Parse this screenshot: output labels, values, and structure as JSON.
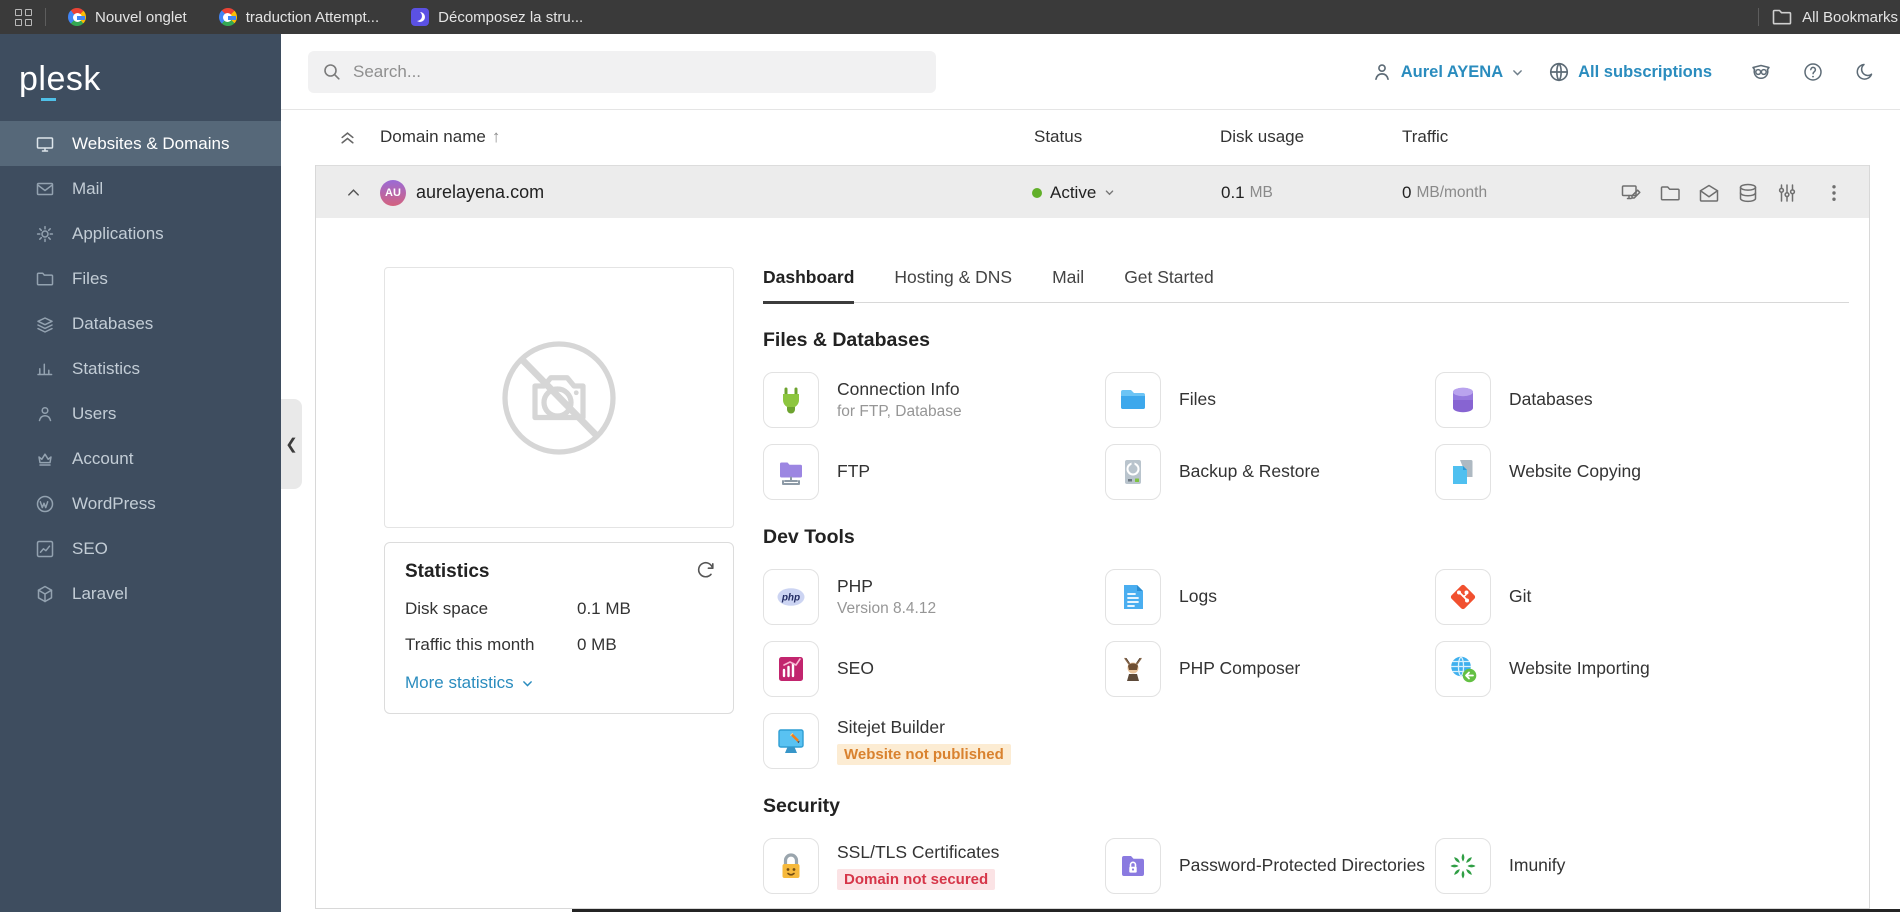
{
  "browser": {
    "tabs": [
      {
        "label": "Nouvel onglet",
        "favicon": "google"
      },
      {
        "label": "traduction Attempt...",
        "favicon": "google"
      },
      {
        "label": "Décomposez la stru...",
        "favicon": "purple"
      }
    ],
    "all_bookmarks_label": "All Bookmarks"
  },
  "sidebar": {
    "logo": "plesk",
    "items": [
      {
        "label": "Websites & Domains",
        "icon": "monitor-icon",
        "active": true
      },
      {
        "label": "Mail",
        "icon": "mail-icon",
        "active": false
      },
      {
        "label": "Applications",
        "icon": "gear-icon",
        "active": false
      },
      {
        "label": "Files",
        "icon": "folder-icon",
        "active": false
      },
      {
        "label": "Databases",
        "icon": "layers-icon",
        "active": false
      },
      {
        "label": "Statistics",
        "icon": "bar-chart-icon",
        "active": false
      },
      {
        "label": "Users",
        "icon": "user-icon",
        "active": false
      },
      {
        "label": "Account",
        "icon": "crown-icon",
        "active": false
      },
      {
        "label": "WordPress",
        "icon": "wordpress-icon",
        "active": false
      },
      {
        "label": "SEO",
        "icon": "seo-chart-icon",
        "active": false
      },
      {
        "label": "Laravel",
        "icon": "laravel-icon",
        "active": false
      }
    ]
  },
  "header": {
    "search_placeholder": "Search...",
    "user_name": "Aurel AYENA",
    "subscriptions_label": "All subscriptions"
  },
  "table": {
    "col_domain": "Domain name",
    "sort_arrow": "↑",
    "col_status": "Status",
    "col_disk": "Disk usage",
    "col_traffic": "Traffic"
  },
  "domain": {
    "avatar_initials": "AU",
    "name": "aurelayena.com",
    "status": "Active",
    "disk_value": "0.1",
    "disk_unit": "MB",
    "traffic_value": "0",
    "traffic_unit": "MB/month",
    "action_icons": [
      "site-preview-icon",
      "folder-outline-icon",
      "mail-outline-icon",
      "database-outline-icon",
      "sliders-icon"
    ]
  },
  "panel": {
    "tabs": [
      {
        "label": "Dashboard",
        "active": true
      },
      {
        "label": "Hosting & DNS",
        "active": false
      },
      {
        "label": "Mail",
        "active": false
      },
      {
        "label": "Get Started",
        "active": false
      }
    ],
    "statistics": {
      "title": "Statistics",
      "rows": [
        {
          "label": "Disk space",
          "value": "0.1 MB"
        },
        {
          "label": "Traffic this month",
          "value": "0 MB"
        }
      ],
      "more_link": "More statistics"
    },
    "sections": [
      {
        "title": "Files & Databases",
        "tiles": [
          {
            "label": "Connection Info",
            "subtitle": "for FTP, Database",
            "icon": "connection-info-icon"
          },
          {
            "label": "Files",
            "icon": "files-icon"
          },
          {
            "label": "Databases",
            "icon": "databases-icon"
          },
          {
            "label": "FTP",
            "icon": "ftp-icon"
          },
          {
            "label": "Backup & Restore",
            "icon": "backup-icon"
          },
          {
            "label": "Website Copying",
            "icon": "website-copying-icon"
          }
        ]
      },
      {
        "title": "Dev Tools",
        "tiles": [
          {
            "label": "PHP",
            "subtitle": "Version 8.4.12",
            "icon": "php-icon"
          },
          {
            "label": "Logs",
            "icon": "logs-icon"
          },
          {
            "label": "Git",
            "icon": "git-icon"
          },
          {
            "label": "SEO",
            "icon": "seo-icon"
          },
          {
            "label": "PHP Composer",
            "icon": "php-composer-icon"
          },
          {
            "label": "Website Importing",
            "icon": "website-importing-icon"
          },
          {
            "label": "Sitejet Builder",
            "icon": "sitejet-icon",
            "badge": {
              "text": "Website not published",
              "color": "orange"
            }
          }
        ]
      },
      {
        "title": "Security",
        "tiles": [
          {
            "label": "SSL/TLS Certificates",
            "icon": "ssl-lock-icon",
            "badge": {
              "text": "Domain not secured",
              "color": "red"
            }
          },
          {
            "label": "Password-Protected Directories",
            "icon": "password-folder-icon"
          },
          {
            "label": "Imunify",
            "icon": "imunify-icon"
          }
        ]
      }
    ]
  },
  "colors": {
    "accent_blue": "#2a8cbe",
    "status_green": "#61af29",
    "sidebar_bg": "#3e4d5f",
    "sidebar_active_bg": "#566879",
    "row_bg": "#ececec",
    "badge_orange_text": "#d9822f",
    "badge_orange_bg": "#fcecd3",
    "badge_red_text": "#d63649",
    "badge_red_bg": "#fbe3e5",
    "logo_underline": "#4fc0e8"
  }
}
